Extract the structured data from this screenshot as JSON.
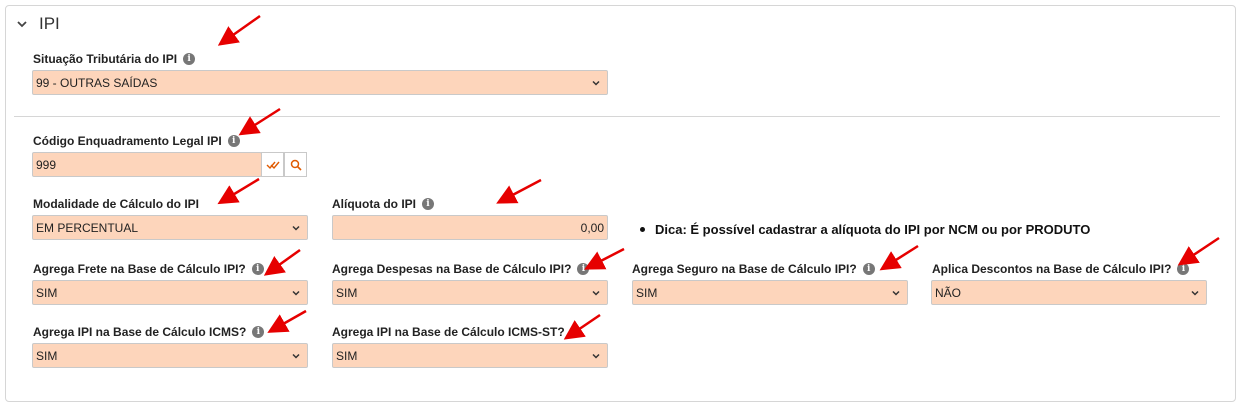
{
  "section": {
    "title": "IPI"
  },
  "fields": {
    "situacao": {
      "label": "Situação Tributária do IPI",
      "value": "99 - OUTRAS SAÍDAS"
    },
    "enquadramento": {
      "label": "Código Enquadramento Legal IPI",
      "value": "999"
    },
    "modalidade": {
      "label": "Modalidade de Cálculo do IPI",
      "value": "EM PERCENTUAL"
    },
    "aliquota": {
      "label": "Alíquota do IPI",
      "value": "0,00"
    },
    "frete": {
      "label": "Agrega Frete na Base de Cálculo IPI?",
      "value": "SIM"
    },
    "despesas": {
      "label": "Agrega Despesas na Base de Cálculo IPI?",
      "value": "SIM"
    },
    "seguro": {
      "label": "Agrega Seguro na Base de Cálculo IPI?",
      "value": "SIM"
    },
    "descontos": {
      "label": "Aplica Descontos na Base de Cálculo IPI?",
      "value": "NÃO"
    },
    "ipi_icms": {
      "label": "Agrega IPI na Base de Cálculo ICMS?",
      "value": "SIM"
    },
    "ipi_icms_st": {
      "label": "Agrega IPI na Base de Cálculo ICMS-ST?",
      "value": "SIM"
    }
  },
  "tip": "Dica: É possível cadastrar a alíquota do IPI por NCM ou por PRODUTO",
  "icons": {
    "info": "i",
    "check": "double-check-icon",
    "search": "search-icon"
  },
  "colors": {
    "field_bg": "#fdd5bb",
    "arrow": "#e60000",
    "addon_icon": "#e05a00"
  }
}
